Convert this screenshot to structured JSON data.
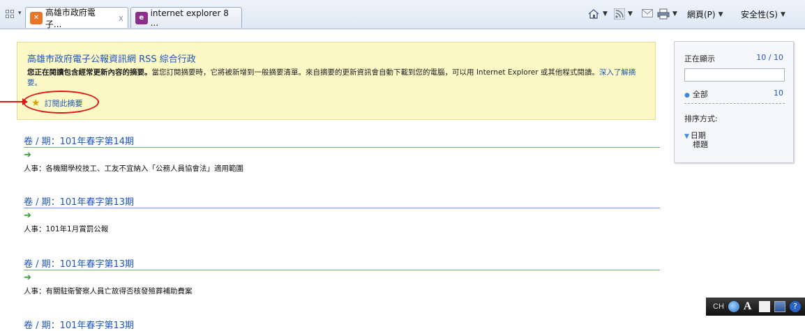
{
  "browser": {
    "tabs": [
      {
        "label": "高雄市政府電子...",
        "close": "x",
        "icon": "kaohsiung-site-icon"
      },
      {
        "label": "internet explorer 8 ...",
        "icon": "rss-feed-icon"
      }
    ],
    "commands": {
      "page_label": "網頁(P)",
      "safety_label": "安全性(S)"
    }
  },
  "feed_header": {
    "title": "高雄市政府電子公報資訊網 RSS 綜合行政",
    "description_bold": "您正在閱讀包含經常更新內容的摘要。",
    "description": "當您訂閱摘要時，它將被新增到一般摘要清單。來自摘要的更新資訊會自動下載到您的電腦，可以用 Internet Explorer 或其他程式閱讀。",
    "learn_more": "深入了解摘要。",
    "subscribe_label": "訂閱此摘要"
  },
  "entries": [
    {
      "title": "卷 / 期：101年春字第14期",
      "text": "人事：各機關學校技工、工友不宜納入「公務人員協會法」適用範圍"
    },
    {
      "title": "卷 / 期：101年春字第13期",
      "text": "人事：101年1月賞罰公報"
    },
    {
      "title": "卷 / 期：101年春字第13期",
      "text": "人事：有關駐衛警察人員亡故得否核發殮葬補助費案"
    },
    {
      "title": "卷 / 期：101年春字第13期",
      "text": ""
    }
  ],
  "side_panel": {
    "showing_label": "正在顯示",
    "showing_value": "10 / 10",
    "all_label": "全部",
    "all_count": "10",
    "sort_label": "排序方式:",
    "sort_options": [
      "日期",
      "標題"
    ]
  },
  "language_bar": {
    "language": "CH"
  },
  "colors": {
    "feed_box_bg": "#fcf9c7",
    "link_blue": "#1d56b8",
    "annotation_red": "#e01717"
  }
}
